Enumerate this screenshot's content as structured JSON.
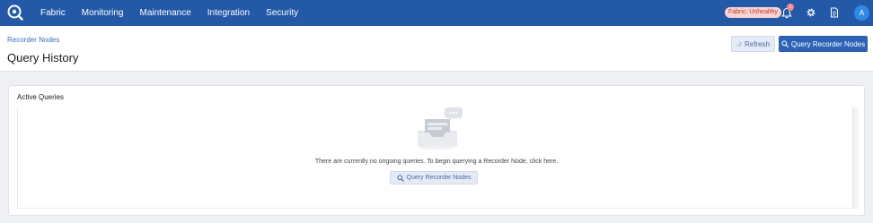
{
  "nav": {
    "items": [
      "Fabric",
      "Monitoring",
      "Maintenance",
      "Integration",
      "Security"
    ]
  },
  "topbar": {
    "status_label": "Fabric: Unhealthy",
    "notifications_count": "1",
    "avatar_letter": "A",
    "colors": {
      "bar": "#2459a7",
      "status_bg": "#f7d3d3",
      "status_text": "#c0392b",
      "avatar": "#2f8ae6"
    },
    "icons": [
      "logo-icon",
      "bell-icon",
      "gear-icon",
      "document-icon"
    ]
  },
  "page": {
    "breadcrumb": "Recorder Nodes",
    "title": "Query History",
    "refresh_label": "Refresh",
    "query_button_label": "Query Recorder Nodes"
  },
  "card": {
    "title": "Active Queries",
    "empty_message": "There are currently no ongoing queries. To begin querying a Recorder Node, click here.",
    "empty_button_label": "Query Recorder Nodes",
    "icons": [
      "empty-inbox-icon",
      "search-icon"
    ]
  }
}
